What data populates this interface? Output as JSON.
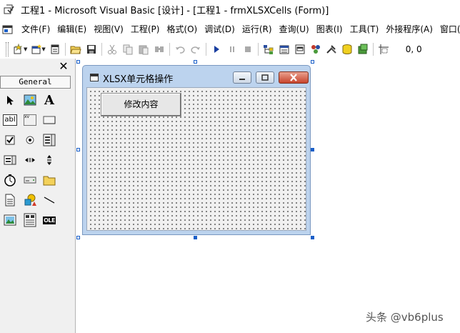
{
  "window": {
    "title": "工程1 - Microsoft Visual Basic [设计] - [工程1 - frmXLSXCells (Form)]"
  },
  "menu": {
    "items": [
      {
        "label": "文件(F)"
      },
      {
        "label": "编辑(E)"
      },
      {
        "label": "视图(V)"
      },
      {
        "label": "工程(P)"
      },
      {
        "label": "格式(O)"
      },
      {
        "label": "调试(D)"
      },
      {
        "label": "运行(R)"
      },
      {
        "label": "查询(U)"
      },
      {
        "label": "图表(I)"
      },
      {
        "label": "工具(T)"
      },
      {
        "label": "外接程序(A)"
      },
      {
        "label": "窗口(W)"
      }
    ]
  },
  "toolbar": {
    "coords": "0, 0",
    "icons": [
      "add-project-icon",
      "add-form-icon",
      "menu-editor-icon",
      "open-icon",
      "save-icon",
      "cut-icon",
      "copy-icon",
      "paste-icon",
      "find-icon",
      "undo-icon",
      "redo-icon",
      "run-icon",
      "break-icon",
      "stop-icon",
      "project-explorer-icon",
      "properties-icon",
      "form-layout-icon",
      "object-browser-icon",
      "toolbox-icon",
      "data-view-icon",
      "component-manager-icon",
      "position-icon"
    ]
  },
  "toolbox": {
    "tab_label": "General",
    "close_label": "✕",
    "tools": [
      {
        "name": "pointer-tool-icon"
      },
      {
        "name": "picturebox-tool-icon"
      },
      {
        "name": "label-tool-icon",
        "glyph": "A"
      },
      {
        "name": "textbox-tool-icon",
        "glyph": "abl"
      },
      {
        "name": "frame-tool-icon",
        "glyph": "xv"
      },
      {
        "name": "commandbutton-tool-icon"
      },
      {
        "name": "checkbox-tool-icon"
      },
      {
        "name": "optionbutton-tool-icon"
      },
      {
        "name": "combobox-tool-icon"
      },
      {
        "name": "listbox-tool-icon"
      },
      {
        "name": "hscrollbar-tool-icon"
      },
      {
        "name": "vscrollbar-tool-icon"
      },
      {
        "name": "timer-tool-icon"
      },
      {
        "name": "drivelistbox-tool-icon"
      },
      {
        "name": "dirlistbox-tool-icon"
      },
      {
        "name": "filelistbox-tool-icon"
      },
      {
        "name": "shape-tool-icon"
      },
      {
        "name": "line-tool-icon"
      },
      {
        "name": "image-tool-icon"
      },
      {
        "name": "data-tool-icon"
      },
      {
        "name": "ole-tool-icon",
        "glyph": "OLE"
      }
    ]
  },
  "form": {
    "caption": "XLSX单元格操作",
    "button_label": "修改内容"
  },
  "watermark": "头条 @vb6plus",
  "colors": {
    "form_frame": "#bcd3ee",
    "close_button": "#c8452d",
    "selection_handle": "#1a5fc8"
  }
}
